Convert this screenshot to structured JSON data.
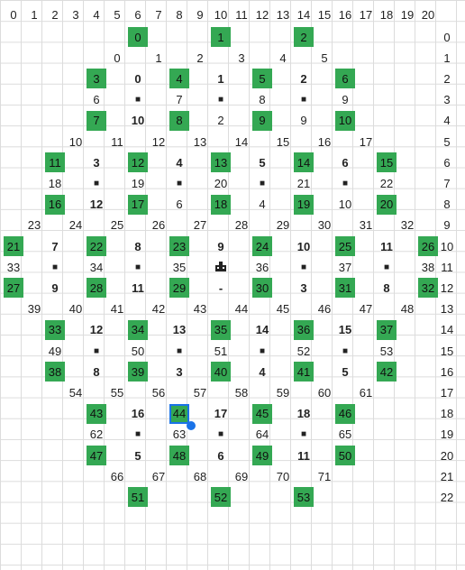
{
  "header_cols": [
    "0",
    "1",
    "2",
    "3",
    "4",
    "5",
    "6",
    "7",
    "8",
    "9",
    "10",
    "11",
    "12",
    "13",
    "14",
    "15",
    "16",
    "17",
    "18",
    "19",
    "20"
  ],
  "row_labels": [
    "0",
    "1",
    "2",
    "3",
    "4",
    "5",
    "6",
    "7",
    "8",
    "9",
    "10",
    "11",
    "12",
    "13",
    "14",
    "15",
    "16",
    "17",
    "18",
    "19",
    "20",
    "21",
    "22"
  ],
  "cells": [
    {
      "c": 6,
      "r": 0,
      "t": "0",
      "g": 1
    },
    {
      "c": 10,
      "r": 0,
      "t": "1",
      "g": 1
    },
    {
      "c": 14,
      "r": 0,
      "t": "2",
      "g": 1
    },
    {
      "c": 5,
      "r": 1,
      "t": "0"
    },
    {
      "c": 7,
      "r": 1,
      "t": "1"
    },
    {
      "c": 9,
      "r": 1,
      "t": "2"
    },
    {
      "c": 11,
      "r": 1,
      "t": "3"
    },
    {
      "c": 13,
      "r": 1,
      "t": "4"
    },
    {
      "c": 15,
      "r": 1,
      "t": "5"
    },
    {
      "c": 4,
      "r": 2,
      "t": "3",
      "g": 1
    },
    {
      "c": 6,
      "r": 2,
      "t": "0",
      "b": 1
    },
    {
      "c": 8,
      "r": 2,
      "t": "4",
      "g": 1
    },
    {
      "c": 10,
      "r": 2,
      "t": "1",
      "b": 1
    },
    {
      "c": 12,
      "r": 2,
      "t": "5",
      "g": 1
    },
    {
      "c": 14,
      "r": 2,
      "t": "2",
      "b": 1
    },
    {
      "c": 16,
      "r": 2,
      "t": "6",
      "g": 1
    },
    {
      "c": 4,
      "r": 3,
      "t": "6"
    },
    {
      "c": 6,
      "r": 3,
      "t": "■"
    },
    {
      "c": 8,
      "r": 3,
      "t": "7"
    },
    {
      "c": 10,
      "r": 3,
      "t": "■"
    },
    {
      "c": 12,
      "r": 3,
      "t": "8"
    },
    {
      "c": 14,
      "r": 3,
      "t": "■"
    },
    {
      "c": 16,
      "r": 3,
      "t": "9"
    },
    {
      "c": 4,
      "r": 4,
      "t": "7",
      "g": 1
    },
    {
      "c": 6,
      "r": 4,
      "t": "10",
      "b": 1
    },
    {
      "c": 8,
      "r": 4,
      "t": "8",
      "g": 1
    },
    {
      "c": 10,
      "r": 4,
      "t": "2"
    },
    {
      "c": 12,
      "r": 4,
      "t": "9",
      "g": 1
    },
    {
      "c": 14,
      "r": 4,
      "t": "9"
    },
    {
      "c": 16,
      "r": 4,
      "t": "10",
      "g": 1
    },
    {
      "c": 3,
      "r": 5,
      "t": "10"
    },
    {
      "c": 5,
      "r": 5,
      "t": "11"
    },
    {
      "c": 7,
      "r": 5,
      "t": "12"
    },
    {
      "c": 9,
      "r": 5,
      "t": "13"
    },
    {
      "c": 11,
      "r": 5,
      "t": "14"
    },
    {
      "c": 13,
      "r": 5,
      "t": "15"
    },
    {
      "c": 15,
      "r": 5,
      "t": "16"
    },
    {
      "c": 17,
      "r": 5,
      "t": "17"
    },
    {
      "c": 2,
      "r": 6,
      "t": "11",
      "g": 1
    },
    {
      "c": 4,
      "r": 6,
      "t": "3",
      "b": 1
    },
    {
      "c": 6,
      "r": 6,
      "t": "12",
      "g": 1
    },
    {
      "c": 8,
      "r": 6,
      "t": "4",
      "b": 1
    },
    {
      "c": 10,
      "r": 6,
      "t": "13",
      "g": 1
    },
    {
      "c": 12,
      "r": 6,
      "t": "5",
      "b": 1
    },
    {
      "c": 14,
      "r": 6,
      "t": "14",
      "g": 1
    },
    {
      "c": 16,
      "r": 6,
      "t": "6",
      "b": 1
    },
    {
      "c": 18,
      "r": 6,
      "t": "15",
      "g": 1
    },
    {
      "c": 2,
      "r": 7,
      "t": "18"
    },
    {
      "c": 4,
      "r": 7,
      "t": "■"
    },
    {
      "c": 6,
      "r": 7,
      "t": "19"
    },
    {
      "c": 8,
      "r": 7,
      "t": "■"
    },
    {
      "c": 10,
      "r": 7,
      "t": "20"
    },
    {
      "c": 12,
      "r": 7,
      "t": "■"
    },
    {
      "c": 14,
      "r": 7,
      "t": "21"
    },
    {
      "c": 16,
      "r": 7,
      "t": "■"
    },
    {
      "c": 18,
      "r": 7,
      "t": "22"
    },
    {
      "c": 2,
      "r": 8,
      "t": "16",
      "g": 1
    },
    {
      "c": 4,
      "r": 8,
      "t": "12",
      "b": 1
    },
    {
      "c": 6,
      "r": 8,
      "t": "17",
      "g": 1
    },
    {
      "c": 8,
      "r": 8,
      "t": "6"
    },
    {
      "c": 10,
      "r": 8,
      "t": "18",
      "g": 1
    },
    {
      "c": 12,
      "r": 8,
      "t": "4"
    },
    {
      "c": 14,
      "r": 8,
      "t": "19",
      "g": 1
    },
    {
      "c": 16,
      "r": 8,
      "t": "10"
    },
    {
      "c": 18,
      "r": 8,
      "t": "20",
      "g": 1
    },
    {
      "c": 1,
      "r": 9,
      "t": "23"
    },
    {
      "c": 3,
      "r": 9,
      "t": "24"
    },
    {
      "c": 5,
      "r": 9,
      "t": "25"
    },
    {
      "c": 7,
      "r": 9,
      "t": "26"
    },
    {
      "c": 9,
      "r": 9,
      "t": "27"
    },
    {
      "c": 11,
      "r": 9,
      "t": "28"
    },
    {
      "c": 13,
      "r": 9,
      "t": "29"
    },
    {
      "c": 15,
      "r": 9,
      "t": "30"
    },
    {
      "c": 17,
      "r": 9,
      "t": "31"
    },
    {
      "c": 19,
      "r": 9,
      "t": "32"
    },
    {
      "c": 0,
      "r": 10,
      "t": "21",
      "g": 1
    },
    {
      "c": 2,
      "r": 10,
      "t": "7",
      "b": 1
    },
    {
      "c": 4,
      "r": 10,
      "t": "22",
      "g": 1
    },
    {
      "c": 6,
      "r": 10,
      "t": "8",
      "b": 1
    },
    {
      "c": 8,
      "r": 10,
      "t": "23",
      "g": 1
    },
    {
      "c": 10,
      "r": 10,
      "t": "9",
      "b": 1
    },
    {
      "c": 12,
      "r": 10,
      "t": "24",
      "g": 1
    },
    {
      "c": 14,
      "r": 10,
      "t": "10",
      "b": 1
    },
    {
      "c": 16,
      "r": 10,
      "t": "25",
      "g": 1
    },
    {
      "c": 18,
      "r": 10,
      "t": "11",
      "b": 1
    },
    {
      "c": 20,
      "r": 10,
      "t": "26",
      "g": 1
    },
    {
      "c": 0,
      "r": 11,
      "t": "33"
    },
    {
      "c": 2,
      "r": 11,
      "t": "■"
    },
    {
      "c": 4,
      "r": 11,
      "t": "34"
    },
    {
      "c": 6,
      "r": 11,
      "t": "■"
    },
    {
      "c": 8,
      "r": 11,
      "t": "35"
    },
    {
      "c": 10,
      "r": 11,
      "t": "icon"
    },
    {
      "c": 12,
      "r": 11,
      "t": "36"
    },
    {
      "c": 14,
      "r": 11,
      "t": "■"
    },
    {
      "c": 16,
      "r": 11,
      "t": "37"
    },
    {
      "c": 18,
      "r": 11,
      "t": "■"
    },
    {
      "c": 20,
      "r": 11,
      "t": "38"
    },
    {
      "c": 0,
      "r": 12,
      "t": "27",
      "g": 1
    },
    {
      "c": 2,
      "r": 12,
      "t": "9",
      "b": 1
    },
    {
      "c": 4,
      "r": 12,
      "t": "28",
      "g": 1
    },
    {
      "c": 6,
      "r": 12,
      "t": "11",
      "b": 1
    },
    {
      "c": 8,
      "r": 12,
      "t": "29",
      "g": 1
    },
    {
      "c": 10,
      "r": 12,
      "t": "-",
      "b": 1
    },
    {
      "c": 12,
      "r": 12,
      "t": "30",
      "g": 1
    },
    {
      "c": 14,
      "r": 12,
      "t": "3",
      "b": 1
    },
    {
      "c": 16,
      "r": 12,
      "t": "31",
      "g": 1
    },
    {
      "c": 18,
      "r": 12,
      "t": "8",
      "b": 1
    },
    {
      "c": 20,
      "r": 12,
      "t": "32",
      "g": 1
    },
    {
      "c": 1,
      "r": 13,
      "t": "39"
    },
    {
      "c": 3,
      "r": 13,
      "t": "40"
    },
    {
      "c": 5,
      "r": 13,
      "t": "41"
    },
    {
      "c": 7,
      "r": 13,
      "t": "42"
    },
    {
      "c": 9,
      "r": 13,
      "t": "43"
    },
    {
      "c": 11,
      "r": 13,
      "t": "44"
    },
    {
      "c": 13,
      "r": 13,
      "t": "45"
    },
    {
      "c": 15,
      "r": 13,
      "t": "46"
    },
    {
      "c": 17,
      "r": 13,
      "t": "47"
    },
    {
      "c": 19,
      "r": 13,
      "t": "48"
    },
    {
      "c": 2,
      "r": 14,
      "t": "33",
      "g": 1
    },
    {
      "c": 4,
      "r": 14,
      "t": "12",
      "b": 1
    },
    {
      "c": 6,
      "r": 14,
      "t": "34",
      "g": 1
    },
    {
      "c": 8,
      "r": 14,
      "t": "13",
      "b": 1
    },
    {
      "c": 10,
      "r": 14,
      "t": "35",
      "g": 1
    },
    {
      "c": 12,
      "r": 14,
      "t": "14",
      "b": 1
    },
    {
      "c": 14,
      "r": 14,
      "t": "36",
      "g": 1
    },
    {
      "c": 16,
      "r": 14,
      "t": "15",
      "b": 1
    },
    {
      "c": 18,
      "r": 14,
      "t": "37",
      "g": 1
    },
    {
      "c": 2,
      "r": 15,
      "t": "49"
    },
    {
      "c": 4,
      "r": 15,
      "t": "■"
    },
    {
      "c": 6,
      "r": 15,
      "t": "50"
    },
    {
      "c": 8,
      "r": 15,
      "t": "■"
    },
    {
      "c": 10,
      "r": 15,
      "t": "51"
    },
    {
      "c": 12,
      "r": 15,
      "t": "■"
    },
    {
      "c": 14,
      "r": 15,
      "t": "52"
    },
    {
      "c": 16,
      "r": 15,
      "t": "■"
    },
    {
      "c": 18,
      "r": 15,
      "t": "53"
    },
    {
      "c": 2,
      "r": 16,
      "t": "38",
      "g": 1
    },
    {
      "c": 4,
      "r": 16,
      "t": "8",
      "b": 1
    },
    {
      "c": 6,
      "r": 16,
      "t": "39",
      "g": 1
    },
    {
      "c": 8,
      "r": 16,
      "t": "3",
      "b": 1
    },
    {
      "c": 10,
      "r": 16,
      "t": "40",
      "g": 1
    },
    {
      "c": 12,
      "r": 16,
      "t": "4",
      "b": 1
    },
    {
      "c": 14,
      "r": 16,
      "t": "41",
      "g": 1
    },
    {
      "c": 16,
      "r": 16,
      "t": "5",
      "b": 1
    },
    {
      "c": 18,
      "r": 16,
      "t": "42",
      "g": 1
    },
    {
      "c": 3,
      "r": 17,
      "t": "54"
    },
    {
      "c": 5,
      "r": 17,
      "t": "55"
    },
    {
      "c": 7,
      "r": 17,
      "t": "56"
    },
    {
      "c": 9,
      "r": 17,
      "t": "57"
    },
    {
      "c": 11,
      "r": 17,
      "t": "58"
    },
    {
      "c": 13,
      "r": 17,
      "t": "59"
    },
    {
      "c": 15,
      "r": 17,
      "t": "60"
    },
    {
      "c": 17,
      "r": 17,
      "t": "61"
    },
    {
      "c": 4,
      "r": 18,
      "t": "43",
      "g": 1
    },
    {
      "c": 6,
      "r": 18,
      "t": "16",
      "b": 1
    },
    {
      "c": 8,
      "r": 18,
      "t": "44",
      "g": 1,
      "sel": 1
    },
    {
      "c": 10,
      "r": 18,
      "t": "17",
      "b": 1
    },
    {
      "c": 12,
      "r": 18,
      "t": "45",
      "g": 1
    },
    {
      "c": 14,
      "r": 18,
      "t": "18",
      "b": 1
    },
    {
      "c": 16,
      "r": 18,
      "t": "46",
      "g": 1
    },
    {
      "c": 4,
      "r": 19,
      "t": "62"
    },
    {
      "c": 6,
      "r": 19,
      "t": "■"
    },
    {
      "c": 8,
      "r": 19,
      "t": "63"
    },
    {
      "c": 10,
      "r": 19,
      "t": "■"
    },
    {
      "c": 12,
      "r": 19,
      "t": "64"
    },
    {
      "c": 14,
      "r": 19,
      "t": "■"
    },
    {
      "c": 16,
      "r": 19,
      "t": "65"
    },
    {
      "c": 4,
      "r": 20,
      "t": "47",
      "g": 1
    },
    {
      "c": 6,
      "r": 20,
      "t": "5",
      "b": 1
    },
    {
      "c": 8,
      "r": 20,
      "t": "48",
      "g": 1
    },
    {
      "c": 10,
      "r": 20,
      "t": "6",
      "b": 1
    },
    {
      "c": 12,
      "r": 20,
      "t": "49",
      "g": 1
    },
    {
      "c": 14,
      "r": 20,
      "t": "11",
      "b": 1
    },
    {
      "c": 16,
      "r": 20,
      "t": "50",
      "g": 1
    },
    {
      "c": 5,
      "r": 21,
      "t": "66"
    },
    {
      "c": 7,
      "r": 21,
      "t": "67"
    },
    {
      "c": 9,
      "r": 21,
      "t": "68"
    },
    {
      "c": 11,
      "r": 21,
      "t": "69"
    },
    {
      "c": 13,
      "r": 21,
      "t": "70"
    },
    {
      "c": 15,
      "r": 21,
      "t": "71"
    },
    {
      "c": 6,
      "r": 22,
      "t": "51",
      "g": 1
    },
    {
      "c": 10,
      "r": 22,
      "t": "52",
      "g": 1
    },
    {
      "c": 14,
      "r": 22,
      "t": "53",
      "g": 1
    }
  ],
  "colors": {
    "green": "#34a853",
    "selection": "#1a73e8"
  }
}
